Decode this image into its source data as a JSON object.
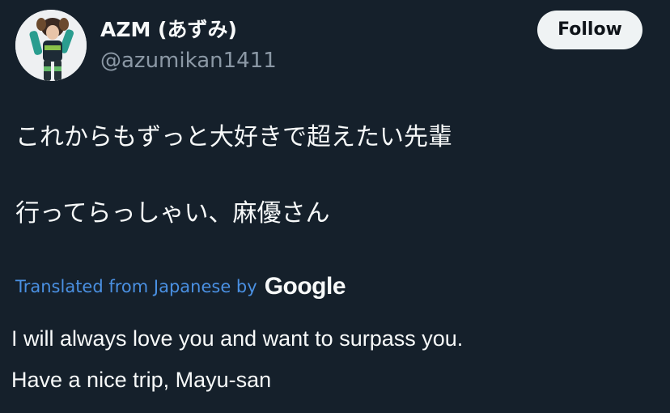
{
  "user": {
    "display_name": "AZM (あずみ)",
    "handle": "@azumikan1411",
    "follow_label": "Follow",
    "avatar_icon": "profile-photo"
  },
  "tweet": {
    "lines": [
      "これからもずっと大好きで超えたい先輩",
      "行ってらっしゃい、麻優さん"
    ]
  },
  "translation": {
    "label": "Translated from Japanese by",
    "provider": "Google",
    "lines": [
      "I will always love you and want to surpass you.",
      "Have a nice trip, Mayu-san"
    ]
  },
  "colors": {
    "background": "#15202b",
    "text": "#f7f9f9",
    "muted": "#8b98a5",
    "link": "#4a90e2",
    "button_bg": "#eff3f4"
  }
}
